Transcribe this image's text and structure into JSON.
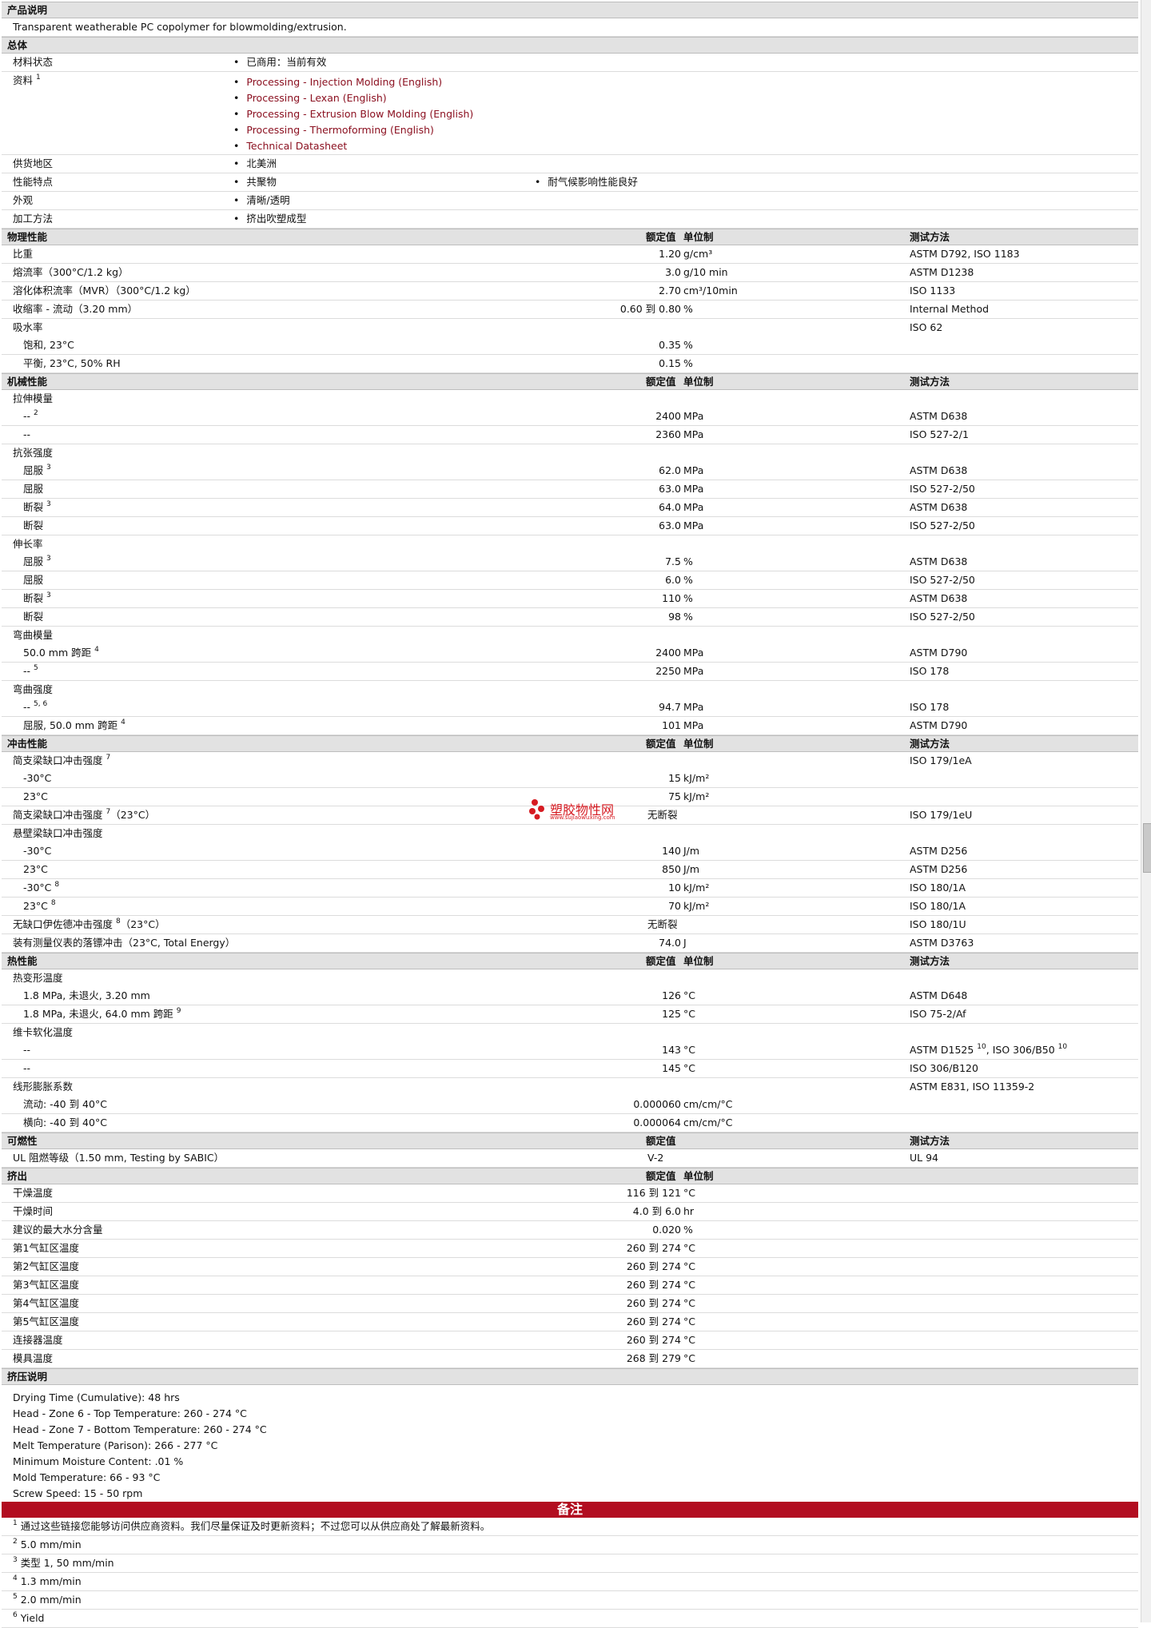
{
  "sections": {
    "desc": "产品说明",
    "general": "总体",
    "physical": "物理性能",
    "mechanical": "机械性能",
    "impact": "冲击性能",
    "thermal": "热性能",
    "flammability": "可燃性",
    "extrusion": "挤出",
    "extrusion_notes": "挤压说明"
  },
  "headers": {
    "value": "额定值",
    "unit": "单位制",
    "method": "测试方法"
  },
  "description": "Transparent weatherable PC copolymer for blowmolding/extrusion.",
  "general": {
    "status_label": "材料状态",
    "status_value": "已商用：当前有效",
    "docs_label": "资料",
    "docs_sup": "1",
    "docs": [
      "Processing - Injection Molding (English)",
      "Processing - Lexan (English)",
      "Processing - Extrusion Blow Molding (English)",
      "Processing - Thermoforming (English)",
      "Technical Datasheet"
    ],
    "region_label": "供货地区",
    "region_value": "北美洲",
    "features_label": "性能特点",
    "feature1": "共聚物",
    "feature2": "耐气候影响性能良好",
    "appearance_label": "外观",
    "appearance_value": "清晰/透明",
    "method_label": "加工方法",
    "method_value": "挤出吹塑成型"
  },
  "physical": [
    {
      "label": "比重",
      "value": "1.20",
      "unit": "g/cm³",
      "method": "ASTM D792, ISO 1183"
    },
    {
      "label": "熔流率（300°C/1.2 kg）",
      "value": "3.0",
      "unit": "g/10 min",
      "method": "ASTM D1238"
    },
    {
      "label": "溶化体积流率（MVR）（300°C/1.2 kg）",
      "value": "2.70",
      "unit": "cm³/10min",
      "method": "ISO 1133"
    },
    {
      "label": "收缩率 - 流动（3.20 mm）",
      "value": "0.60 到  0.80",
      "unit": "%",
      "method": "Internal Method"
    },
    {
      "label": "吸水率",
      "value": "",
      "unit": "",
      "method": "ISO 62",
      "group": true
    },
    {
      "label": "饱和, 23°C",
      "value": "0.35",
      "unit": "%",
      "method": "",
      "sub": true
    },
    {
      "label": "平衡, 23°C, 50% RH",
      "value": "0.15",
      "unit": "%",
      "method": "",
      "sub": true
    }
  ],
  "mechanical": [
    {
      "label": "拉伸模量",
      "group": true
    },
    {
      "label": "--",
      "sup": "2",
      "value": "2400",
      "unit": "MPa",
      "method": "ASTM D638",
      "sub": true
    },
    {
      "label": "--",
      "value": "2360",
      "unit": "MPa",
      "method": "ISO 527-2/1",
      "sub": true
    },
    {
      "label": "抗张强度",
      "group": true
    },
    {
      "label": "屈服",
      "sup": "3",
      "value": "62.0",
      "unit": "MPa",
      "method": "ASTM D638",
      "sub": true
    },
    {
      "label": "屈服",
      "value": "63.0",
      "unit": "MPa",
      "method": "ISO 527-2/50",
      "sub": true
    },
    {
      "label": "断裂",
      "sup": "3",
      "value": "64.0",
      "unit": "MPa",
      "method": "ASTM D638",
      "sub": true
    },
    {
      "label": "断裂",
      "value": "63.0",
      "unit": "MPa",
      "method": "ISO 527-2/50",
      "sub": true
    },
    {
      "label": "伸长率",
      "group": true
    },
    {
      "label": "屈服",
      "sup": "3",
      "value": "7.5",
      "unit": "%",
      "method": "ASTM D638",
      "sub": true
    },
    {
      "label": "屈服",
      "value": "6.0",
      "unit": "%",
      "method": "ISO 527-2/50",
      "sub": true
    },
    {
      "label": "断裂",
      "sup": "3",
      "value": "110",
      "unit": "%",
      "method": "ASTM D638",
      "sub": true
    },
    {
      "label": "断裂",
      "value": "98",
      "unit": "%",
      "method": "ISO 527-2/50",
      "sub": true
    },
    {
      "label": "弯曲模量",
      "group": true
    },
    {
      "label": "50.0 mm 跨距",
      "sup": "4",
      "value": "2400",
      "unit": "MPa",
      "method": "ASTM D790",
      "sub": true
    },
    {
      "label": "--",
      "sup": "5",
      "value": "2250",
      "unit": "MPa",
      "method": "ISO 178",
      "sub": true
    },
    {
      "label": "弯曲强度",
      "group": true
    },
    {
      "label": "--",
      "sup": "5, 6",
      "value": "94.7",
      "unit": "MPa",
      "method": "ISO 178",
      "sub": true
    },
    {
      "label": "屈服, 50.0 mm 跨距",
      "sup": "4",
      "value": "101",
      "unit": "MPa",
      "method": "ASTM D790",
      "sub": true
    }
  ],
  "impact": [
    {
      "label": "简支梁缺口冲击强度",
      "sup": "7",
      "method": "ISO 179/1eA",
      "group": true
    },
    {
      "label": "-30°C",
      "value": "15",
      "unit": "kJ/m²",
      "sub": true
    },
    {
      "label": "23°C",
      "value": "75",
      "unit": "kJ/m²",
      "sub": true
    },
    {
      "label": "简支梁缺口冲击强度",
      "sup": "7",
      "after": "（23°C）",
      "valc": "无断裂",
      "method": "ISO 179/1eU"
    },
    {
      "label": "悬壁梁缺口冲击强度",
      "group": true
    },
    {
      "label": "-30°C",
      "value": "140",
      "unit": "J/m",
      "method": "ASTM D256",
      "sub": true
    },
    {
      "label": "23°C",
      "value": "850",
      "unit": "J/m",
      "method": "ASTM D256",
      "sub": true
    },
    {
      "label": "-30°C",
      "sup": "8",
      "value": "10",
      "unit": "kJ/m²",
      "method": "ISO 180/1A",
      "sub": true
    },
    {
      "label": "23°C",
      "sup": "8",
      "value": "70",
      "unit": "kJ/m²",
      "method": "ISO 180/1A",
      "sub": true
    },
    {
      "label": "无缺口伊佐德冲击强度",
      "sup": "8",
      "after": "（23°C）",
      "valc": "无断裂",
      "method": "ISO 180/1U"
    },
    {
      "label": "装有测量仪表的落镖冲击（23°C, Total Energy）",
      "value": "74.0",
      "unit": "J",
      "method": "ASTM D3763"
    }
  ],
  "thermal": [
    {
      "label": "热变形温度",
      "group": true
    },
    {
      "label": "1.8 MPa, 未退火, 3.20 mm",
      "value": "126",
      "unit": "°C",
      "method": "ASTM D648",
      "sub": true
    },
    {
      "label": "1.8 MPa, 未退火, 64.0 mm 跨距",
      "sup": "9",
      "value": "125",
      "unit": "°C",
      "method": "ISO 75-2/Af",
      "sub": true
    },
    {
      "label": "维卡软化温度",
      "group": true
    },
    {
      "label": "--",
      "value": "143",
      "unit": "°C",
      "method": "ASTM D1525 ",
      "msup": "10",
      "method2": ", ISO 306/B50 ",
      "msup2": "10",
      "sub": true
    },
    {
      "label": "--",
      "value": "145",
      "unit": "°C",
      "method": "ISO 306/B120",
      "sub": true
    },
    {
      "label": "线形膨胀系数",
      "method": "ASTM E831, ISO 11359-2",
      "group": true
    },
    {
      "label": "流动: -40 到  40°C",
      "value": "0.000060",
      "unit": "cm/cm/°C",
      "sub": true
    },
    {
      "label": "横向: -40 到  40°C",
      "value": "0.000064",
      "unit": "cm/cm/°C",
      "sub": true
    }
  ],
  "flammability": [
    {
      "label": "UL 阻燃等级（1.50 mm, Testing by SABIC）",
      "valc": "V-2",
      "method": "UL 94"
    }
  ],
  "extrusion": [
    {
      "label": "干燥温度",
      "value": "116 到  121",
      "unit": "°C"
    },
    {
      "label": "干燥时间",
      "value": "4.0 到  6.0",
      "unit": "hr"
    },
    {
      "label": "建议的最大水分含量",
      "value": "0.020",
      "unit": "%"
    },
    {
      "label": "第1气缸区温度",
      "value": "260 到  274",
      "unit": "°C"
    },
    {
      "label": "第2气缸区温度",
      "value": "260 到  274",
      "unit": "°C"
    },
    {
      "label": "第3气缸区温度",
      "value": "260 到  274",
      "unit": "°C"
    },
    {
      "label": "第4气缸区温度",
      "value": "260 到  274",
      "unit": "°C"
    },
    {
      "label": "第5气缸区温度",
      "value": "260 到  274",
      "unit": "°C"
    },
    {
      "label": "连接器温度",
      "value": "260 到  274",
      "unit": "°C"
    },
    {
      "label": "模具温度",
      "value": "268 到  279",
      "unit": "°C"
    }
  ],
  "extrusion_notes": [
    "Drying Time (Cumulative): 48 hrs",
    "Head - Zone 6 - Top Temperature: 260 - 274 °C",
    "Head - Zone 7 - Bottom Temperature: 260 - 274 °C",
    "Melt Temperature (Parison): 266 - 277 °C",
    "Minimum Moisture Content: .01 %",
    "Mold Temperature: 66 - 93 °C",
    "Screw Speed: 15 - 50 rpm"
  ],
  "remarks_title": "备注",
  "footnotes": [
    {
      "n": "1",
      "text": "通过这些链接您能够访问供应商资料。我们尽量保证及时更新资料；不过您可以从供应商处了解最新资料。"
    },
    {
      "n": "2",
      "text": "5.0 mm/min"
    },
    {
      "n": "3",
      "text": "类型  1, 50 mm/min"
    },
    {
      "n": "4",
      "text": "1.3 mm/min"
    },
    {
      "n": "5",
      "text": "2.0 mm/min"
    },
    {
      "n": "6",
      "text": "Yield"
    }
  ],
  "watermark": {
    "title": "塑胶物性网",
    "url": "www.sujiaowuxing.com"
  },
  "colors": {
    "link": "#8b1020",
    "remark_bar": "#b20d20",
    "section_bg": "#e2e2e2"
  }
}
